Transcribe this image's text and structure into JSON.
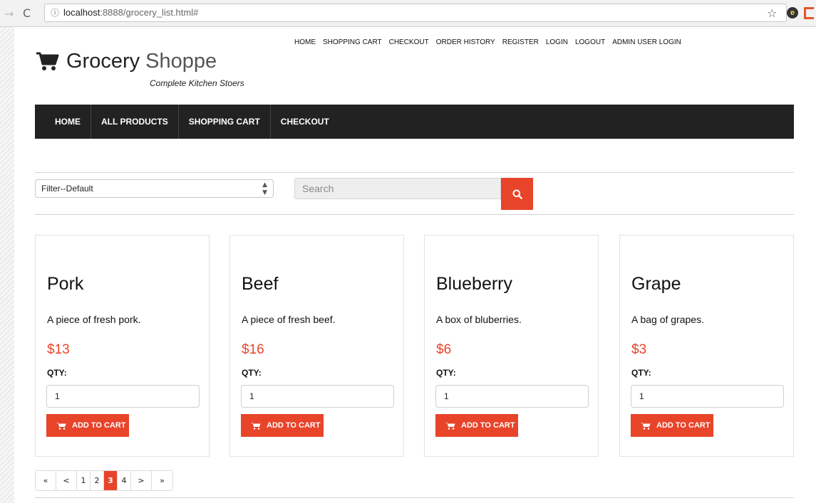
{
  "browser": {
    "url_host": "localhost",
    "url_path": ":8888/grocery_list.html#",
    "back_icon": "back-arrow-icon",
    "reload_icon": "reload-icon",
    "info_icon": "info-icon",
    "bookmark_icon": "star-icon"
  },
  "header": {
    "logo_word1": "Grocery",
    "logo_word2": "Shoppe",
    "tagline": "Complete Kitchen Stoers",
    "top_links": [
      "HOME",
      "SHOPPING CART",
      "CHECKOUT",
      "ORDER HISTORY",
      "REGISTER",
      "LOGIN",
      "LOGOUT",
      "ADMIN USER LOGIN"
    ]
  },
  "mainnav": [
    "HOME",
    "ALL PRODUCTS",
    "SHOPPING CART",
    "CHECKOUT"
  ],
  "toolbar": {
    "filter_value": "Filter--Default",
    "search_placeholder": "Search"
  },
  "products": [
    {
      "name": "Pork",
      "description": "A piece of fresh pork.",
      "price": "$13",
      "qty_label": "QTY:",
      "qty": "1",
      "button": "ADD TO CART"
    },
    {
      "name": "Beef",
      "description": "A piece of fresh beef.",
      "price": "$16",
      "qty_label": "QTY:",
      "qty": "1",
      "button": "ADD TO CART"
    },
    {
      "name": "Blueberry",
      "description": "A box of bluberries.",
      "price": "$6",
      "qty_label": "QTY:",
      "qty": "1",
      "button": "ADD TO CART"
    },
    {
      "name": "Grape",
      "description": "A bag of grapes.",
      "price": "$3",
      "qty_label": "QTY:",
      "qty": "1",
      "button": "ADD TO CART"
    }
  ],
  "pagination": {
    "first": "«",
    "prev": "<",
    "pages": [
      "1",
      "2",
      "3",
      "4"
    ],
    "current": "3",
    "next": ">",
    "last": "»"
  },
  "colors": {
    "accent": "#e8442a",
    "nav_bg": "#222222"
  }
}
